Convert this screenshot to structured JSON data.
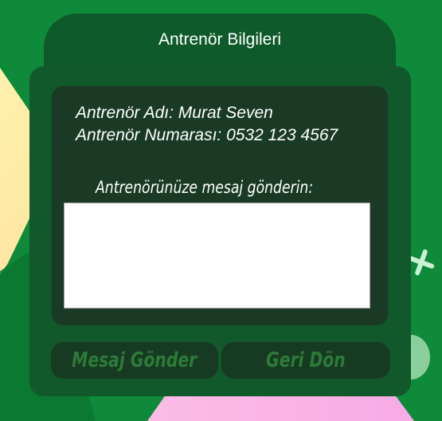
{
  "header": {
    "title": "Antrenör Bilgileri"
  },
  "coach": {
    "name_line": "Antrenör Adı: Murat Seven",
    "phone_line": "Antrenör Numarası: 0532 123 4567"
  },
  "message": {
    "label": "Antrenörünüze mesaj gönderin:",
    "value": ""
  },
  "buttons": {
    "send_label": "Mesaj Gönder",
    "back_label": "Geri Dön"
  },
  "colors": {
    "background": "#0f8a3a",
    "panel": "#11592b",
    "inner_panel": "#1a3a26",
    "button_bg": "#163b22",
    "button_text": "#2e7a3a"
  }
}
